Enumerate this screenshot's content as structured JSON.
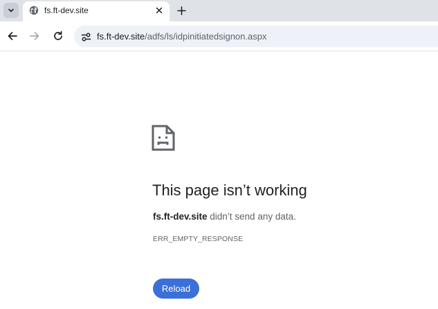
{
  "tab": {
    "title": "fs.ft-dev.site",
    "favicon_icon": "globe-icon",
    "close_icon": "close-icon"
  },
  "tabstrip": {
    "search_icon": "chevron-down-icon",
    "new_tab_icon": "plus-icon"
  },
  "toolbar": {
    "back_icon": "arrow-left-icon",
    "forward_icon": "arrow-right-icon",
    "reload_icon": "reload-icon",
    "site_info_icon": "tune-icon",
    "url_host": "fs.ft-dev.site",
    "url_path": "/adfs/ls/idpinitiatedsignon.aspx"
  },
  "error": {
    "icon": "sad-page-icon",
    "title": "This page isn’t working",
    "host": "fs.ft-dev.site",
    "message": " didn’t send any data.",
    "code": "ERR_EMPTY_RESPONSE",
    "reload_label": "Reload"
  },
  "colors": {
    "tabstrip_bg": "#dfe3e8",
    "omnibox_bg": "#eef1f7",
    "button_blue": "#3b70d9"
  }
}
